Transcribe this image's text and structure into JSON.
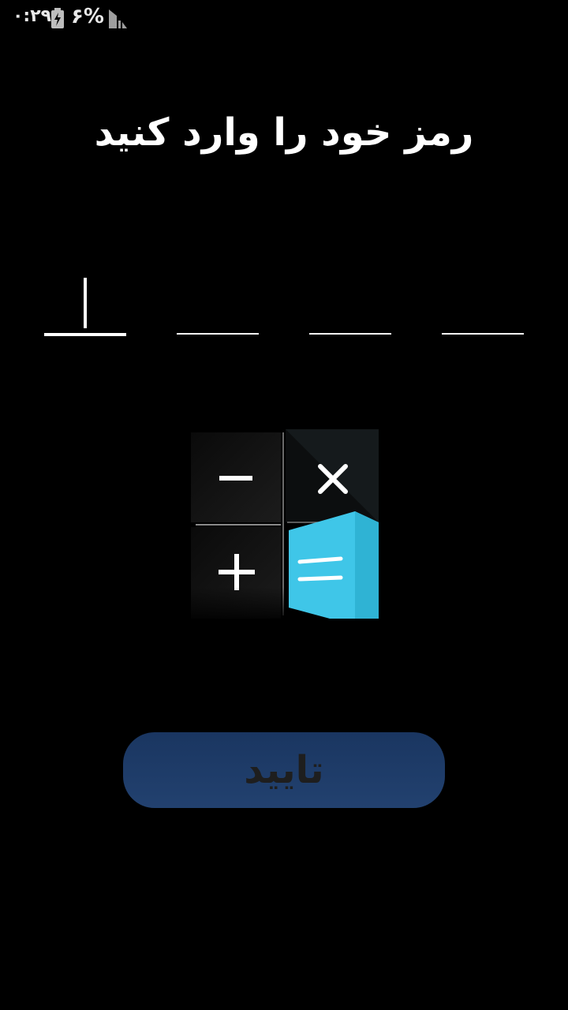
{
  "status_bar": {
    "time": "۰:۲۹",
    "battery_percent": "۶%",
    "battery_icon": "battery-charging-icon",
    "signal_icon": "signal-icon"
  },
  "screen": {
    "title": "رمز خود را وارد کنید",
    "pin": {
      "digits": [
        "",
        "",
        "",
        ""
      ],
      "active_index": 0
    },
    "logo_icon": "calculator-icon",
    "confirm_label": "تایید"
  },
  "colors": {
    "background": "#000000",
    "text": "#ffffff",
    "button": "#1f3d6a",
    "button_text": "#1e1e1e",
    "accent": "#3ec6e8"
  }
}
